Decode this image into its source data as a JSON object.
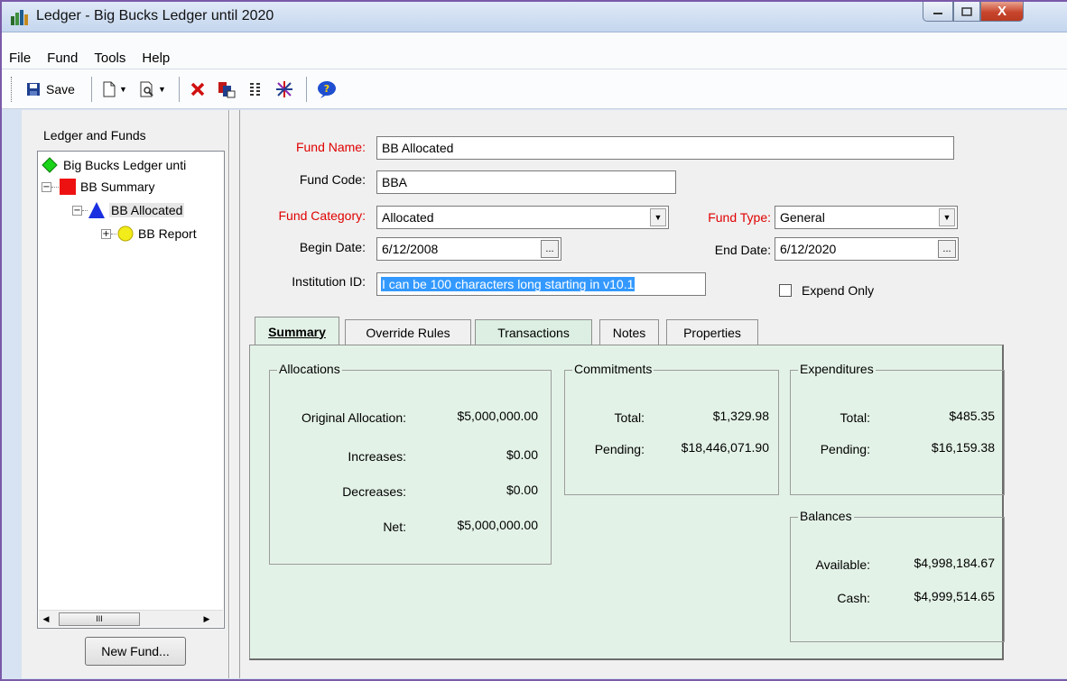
{
  "window": {
    "title": "Ledger - Big Bucks Ledger until 2020",
    "close_glyph": "X"
  },
  "menu": {
    "items": [
      "File",
      "Fund",
      "Tools",
      "Help"
    ]
  },
  "toolbar": {
    "save_label": "Save",
    "icons": [
      "save-icon",
      "new-document-icon",
      "print-preview-icon",
      "delete-icon",
      "report-icon",
      "columns-icon",
      "asterisk-icon",
      "help-icon"
    ]
  },
  "left_panel": {
    "heading": "Ledger and Funds",
    "tree": [
      {
        "label": "Big Bucks Ledger unti",
        "expander": ""
      },
      {
        "label": "BB Summary",
        "expander": "−"
      },
      {
        "label": "BB Allocated",
        "expander": "−"
      },
      {
        "label": "BB Report",
        "expander": "+"
      }
    ],
    "scroll_thumb": "III",
    "new_fund_label": "New Fund..."
  },
  "form": {
    "fund_name_label": "Fund Name:",
    "fund_name_value": "BB Allocated",
    "fund_code_label": "Fund Code:",
    "fund_code_value": "BBA",
    "fund_category_label": "Fund Category:",
    "fund_category_value": "Allocated",
    "fund_type_label": "Fund Type:",
    "fund_type_value": "General",
    "begin_date_label": "Begin Date:",
    "begin_date_value": "6/12/2008",
    "end_date_label": "End Date:",
    "end_date_value": "6/12/2020",
    "institution_id_label": "Institution ID:",
    "institution_id_value": "I can be 100 characters long starting in v10.1",
    "expend_only_label": "Expend Only",
    "ellipsis": "..."
  },
  "tabs": [
    "Summary",
    "Override Rules",
    "Transactions",
    "Notes",
    "Properties"
  ],
  "summary": {
    "allocations": {
      "title": "Allocations",
      "rows": [
        {
          "label": "Original Allocation:",
          "value": "$5,000,000.00"
        },
        {
          "label": "Increases:",
          "value": "$0.00"
        },
        {
          "label": "Decreases:",
          "value": "$0.00"
        },
        {
          "label": "Net:",
          "value": "$5,000,000.00"
        }
      ]
    },
    "commitments": {
      "title": "Commitments",
      "rows": [
        {
          "label": "Total:",
          "value": "$1,329.98"
        },
        {
          "label": "Pending:",
          "value": "$18,446,071.90"
        }
      ]
    },
    "expenditures": {
      "title": "Expenditures",
      "rows": [
        {
          "label": "Total:",
          "value": "$485.35"
        },
        {
          "label": "Pending:",
          "value": "$16,159.38"
        }
      ]
    },
    "balances": {
      "title": "Balances",
      "rows": [
        {
          "label": "Available:",
          "value": "$4,998,184.67"
        },
        {
          "label": "Cash:",
          "value": "$4,999,514.65"
        }
      ]
    }
  },
  "colors": {
    "required_label": "#e00000",
    "tab_panel": "#e3f2e7",
    "selection": "#3399ff"
  }
}
